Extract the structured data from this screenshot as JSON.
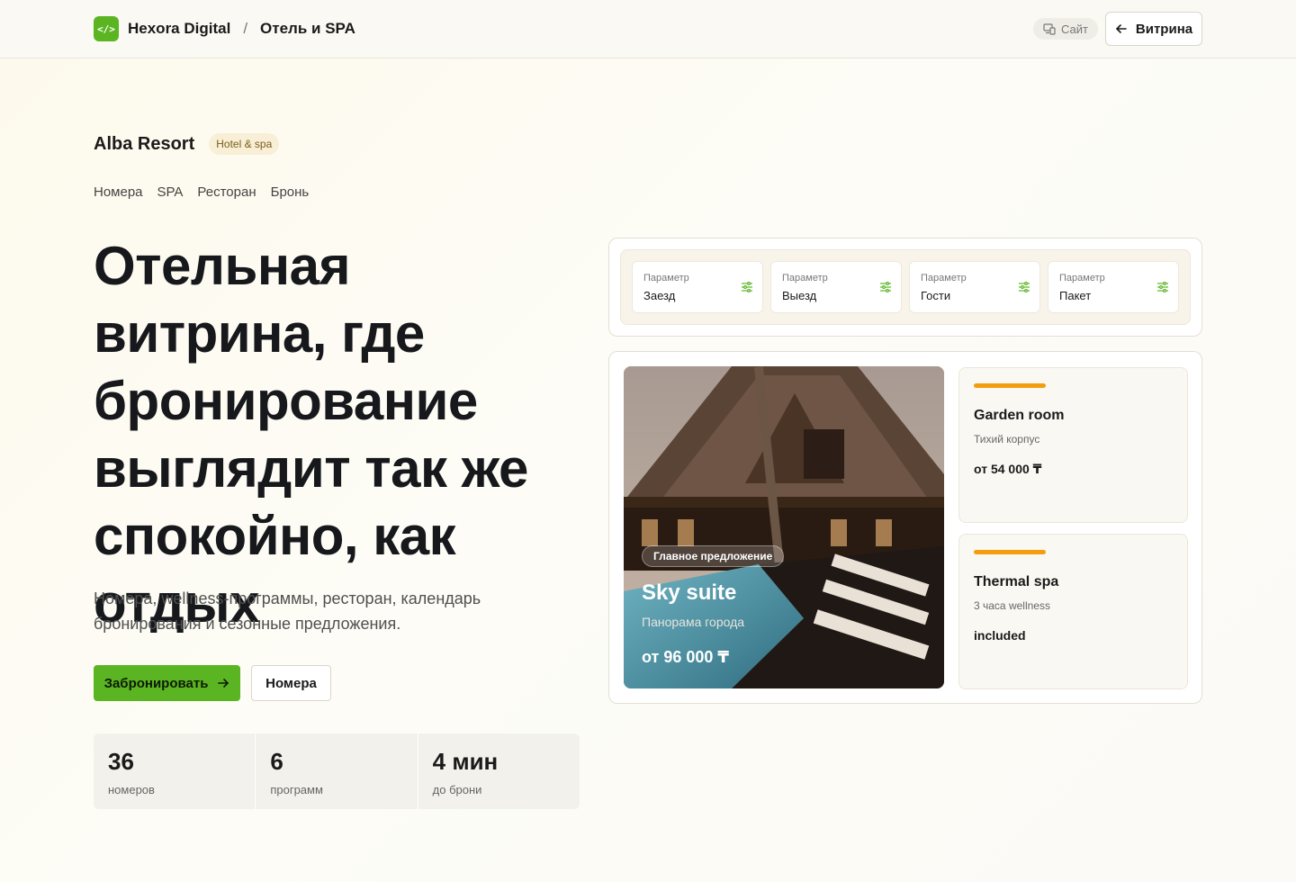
{
  "topbar": {
    "brand_name": "Hexora Digital",
    "separator": "/",
    "section": "Отель и SPA",
    "logo_glyph": "</>",
    "site_label": "Сайт",
    "showcase_label": "Витрина"
  },
  "hero": {
    "resort_name": "Alba Resort",
    "resort_badge": "Hotel & spa",
    "nav": [
      "Номера",
      "SPA",
      "Ресторан",
      "Бронь"
    ],
    "headline": "Отельная витрина, где бронирование выглядит так же спокойно, как отдых",
    "lead": "Номера, wellness-программы, ресторан, календарь бронирования и сезонные предложения.",
    "primary_cta": "Забронировать",
    "secondary_cta": "Номера",
    "stats": [
      {
        "value": "36",
        "label": "номеров"
      },
      {
        "value": "6",
        "label": "программ"
      },
      {
        "value": "4 мин",
        "label": "до брони"
      }
    ]
  },
  "params": [
    {
      "label": "Параметр",
      "value": "Заезд"
    },
    {
      "label": "Параметр",
      "value": "Выезд"
    },
    {
      "label": "Параметр",
      "value": "Гости"
    },
    {
      "label": "Параметр",
      "value": "Пакет"
    }
  ],
  "main_offer": {
    "tag": "Главное предложение",
    "title": "Sky suite",
    "subtitle": "Панорама города",
    "price": "от 96 000 ₸"
  },
  "side_offers": [
    {
      "title": "Garden room",
      "subtitle": "Тихий корпус",
      "price": "от 54 000 ₸"
    },
    {
      "title": "Thermal spa",
      "subtitle": "3 часа wellness",
      "price": "included"
    }
  ],
  "colors": {
    "accent_green": "#5bb523",
    "accent_orange": "#f49d0f"
  }
}
